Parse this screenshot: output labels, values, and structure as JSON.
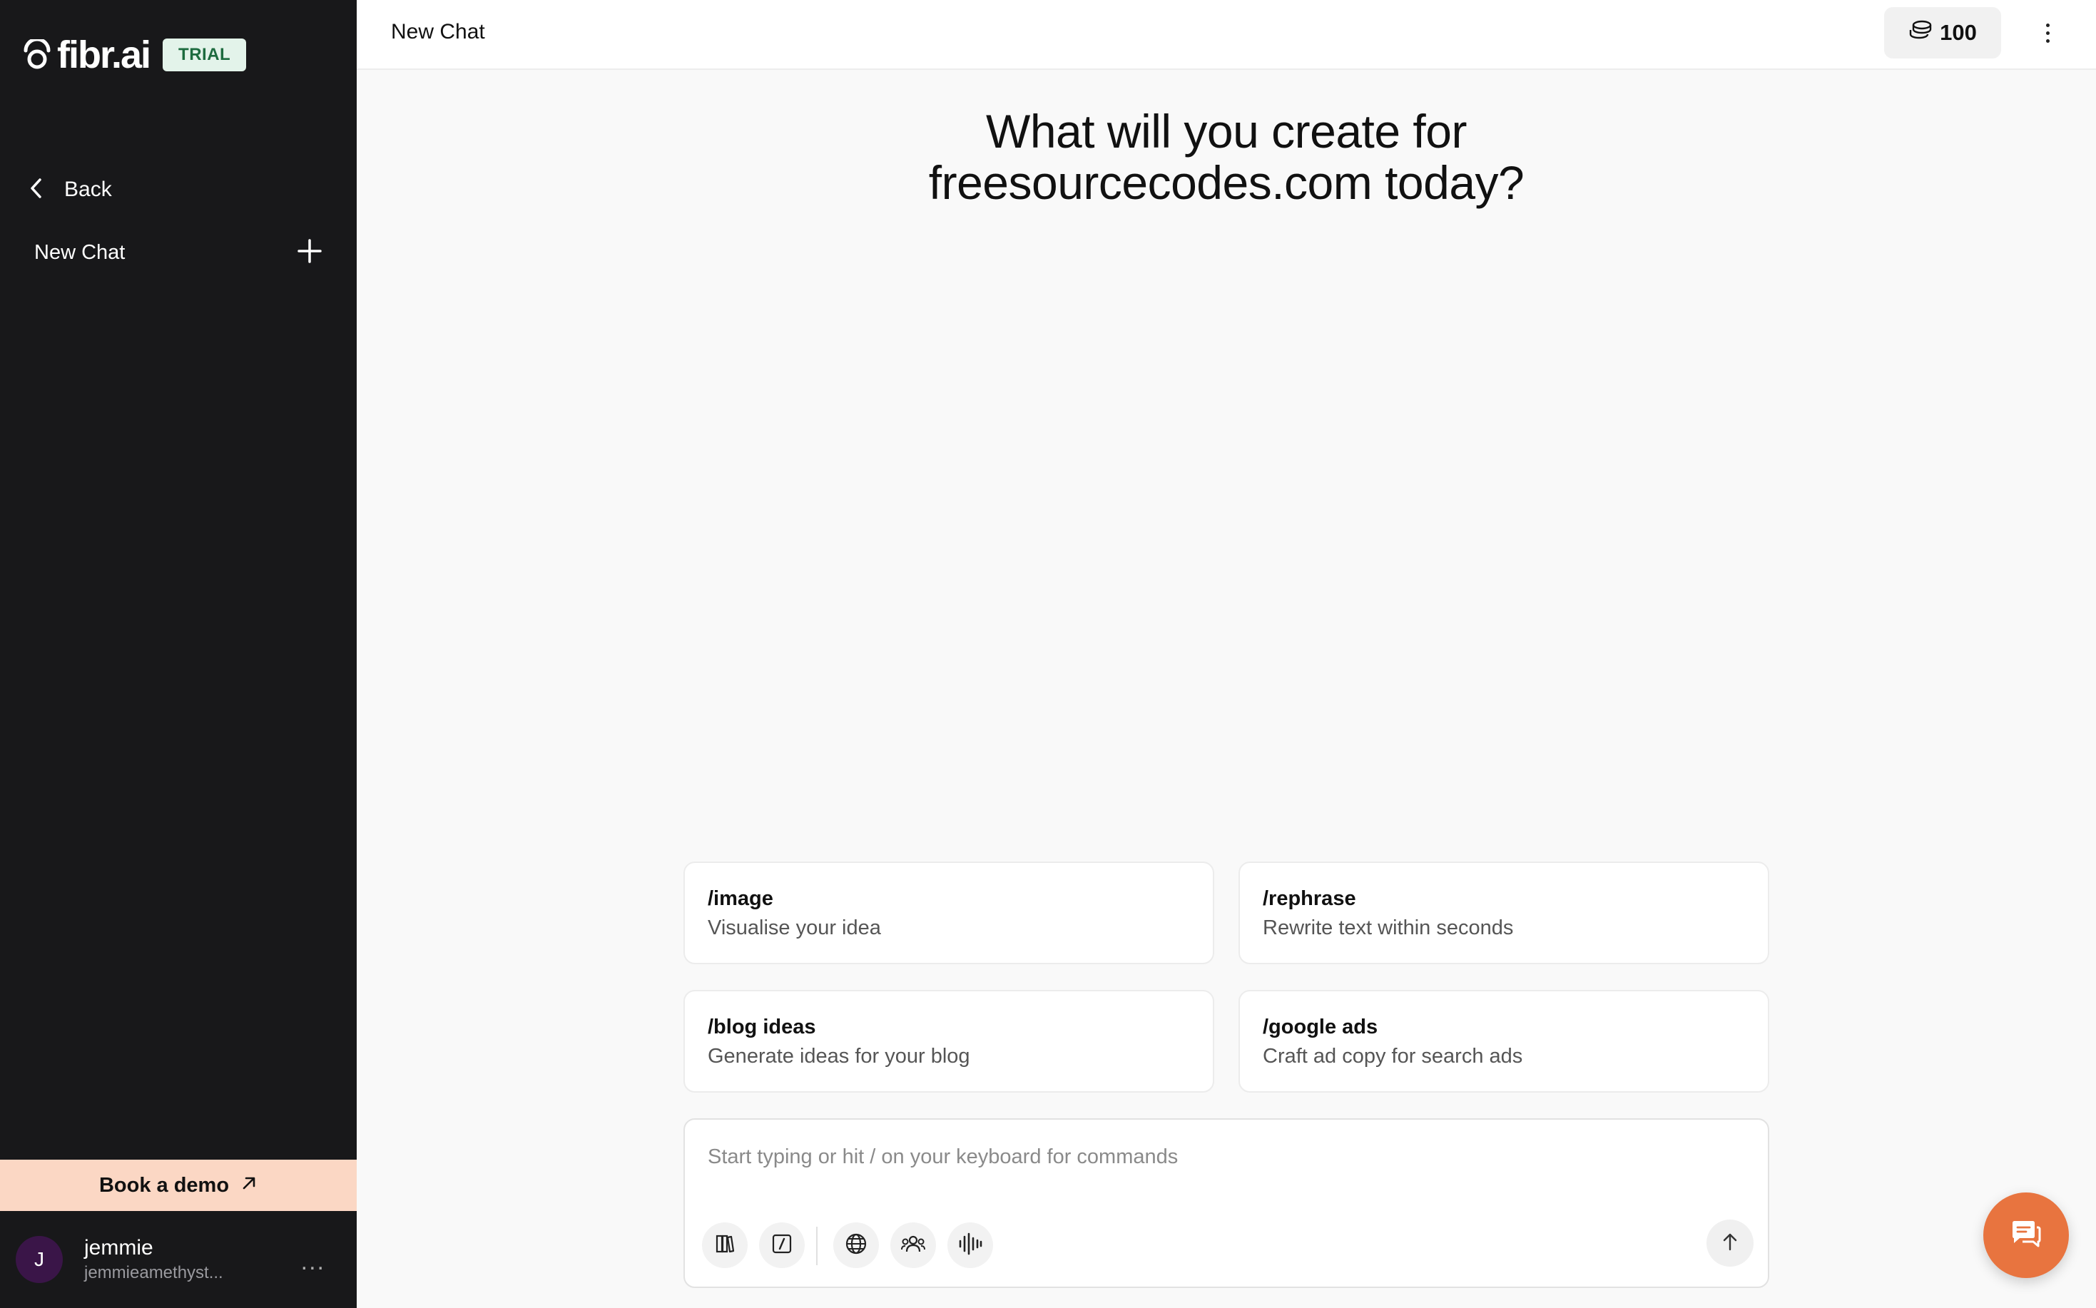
{
  "brand": {
    "name": "fibr.ai",
    "badge": "TRIAL"
  },
  "sidebar": {
    "back_label": "Back",
    "new_chat_label": "New Chat",
    "book_demo_label": "Book a demo",
    "user": {
      "initial": "J",
      "name": "jemmie",
      "email": "jemmieamethyst...",
      "more": "..."
    }
  },
  "header": {
    "title": "New Chat",
    "credits": "100"
  },
  "main": {
    "headline_line1": "What will you create for",
    "headline_line2": "freesourcecodes.com today?",
    "cards": [
      {
        "command": "/image",
        "description": "Visualise your idea"
      },
      {
        "command": "/rephrase",
        "description": "Rewrite text within seconds"
      },
      {
        "command": "/blog ideas",
        "description": "Generate ideas for your blog"
      },
      {
        "command": "/google ads",
        "description": "Craft ad copy for search ads"
      }
    ],
    "composer": {
      "placeholder": "Start typing or hit / on your keyboard for commands",
      "value": ""
    }
  },
  "colors": {
    "sidebar_bg": "#18181a",
    "accent_orange": "#e8743f",
    "book_demo_bg": "#fbd7c4",
    "trial_badge_bg": "#e3f3ea",
    "avatar_bg": "#3a1548"
  },
  "icons": {
    "back": "chevron-left-icon",
    "new_chat": "plus-icon",
    "book_demo": "arrow-up-right-icon",
    "credits": "coins-icon",
    "menu": "vertical-dots-icon",
    "tools": [
      "library-icon",
      "slash-command-icon",
      "globe-icon",
      "people-icon",
      "audio-waveform-icon"
    ],
    "send": "arrow-up-icon",
    "chat_support": "chat-bubble-icon"
  }
}
